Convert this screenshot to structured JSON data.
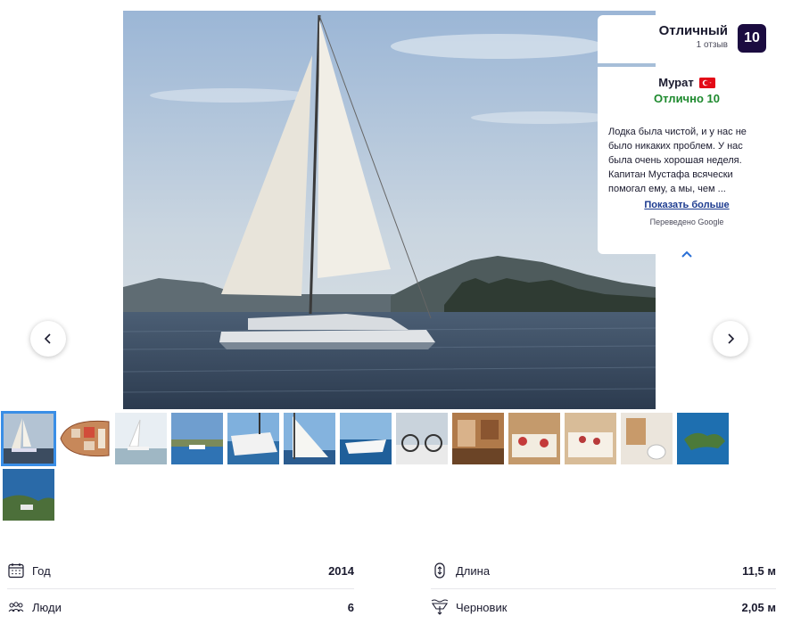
{
  "review": {
    "rating_label": "Отличный",
    "review_count": "1 отзыв",
    "score": "10",
    "reviewer_name": "Мурат",
    "reviewer_grade": "Отлично 10",
    "text": "Лодка была чистой, и у нас не было никаких проблем. У нас была очень хорошая неделя. Капитан Мустафа всячески помогал ему, а мы, чем ...",
    "show_more": "Показать больше",
    "translated_note": "Переведено Google"
  },
  "gallery": {
    "thumbnail_count": 14,
    "active_index": 0
  },
  "specs": {
    "year_label": "Год",
    "year_value": "2014",
    "people_label": "Люди",
    "people_value": "6",
    "length_label": "Длина",
    "length_value": "11,5 м",
    "draft_label": "Черновик",
    "draft_value": "2,05 м"
  },
  "icons": {
    "prev": "chevron-left-icon",
    "next": "chevron-right-icon",
    "collapse": "chevron-up-icon",
    "flag": "turkey-flag-icon",
    "year": "calendar-icon",
    "people": "people-icon",
    "length": "length-icon",
    "draft": "draft-icon"
  },
  "colors": {
    "score_badge": "#1b0c40",
    "grade_green": "#1e8a2e",
    "link_blue": "#1b3a8f",
    "thumb_active": "#3a8ee6"
  }
}
